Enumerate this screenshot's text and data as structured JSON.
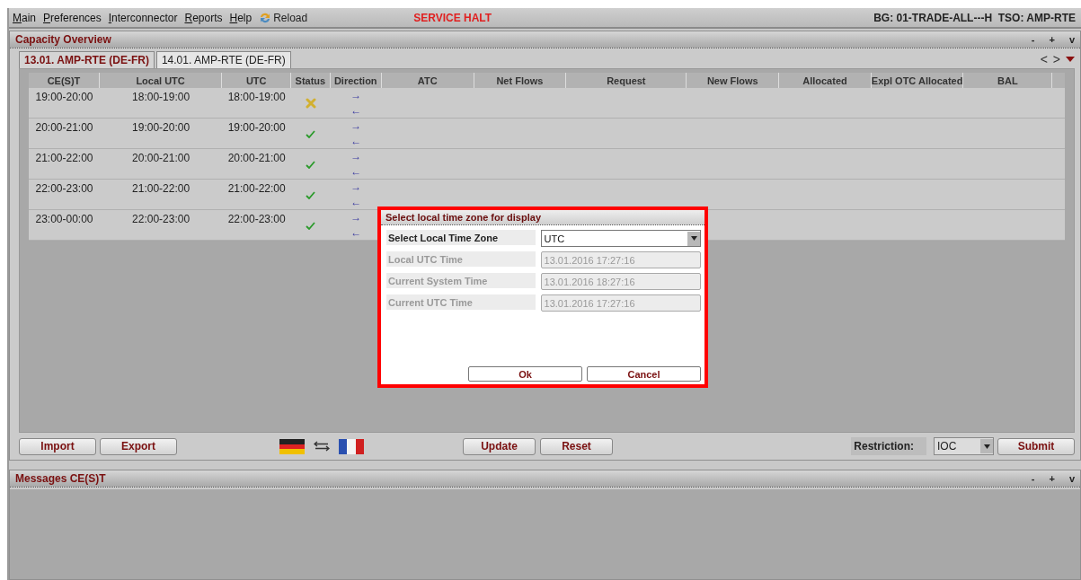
{
  "menu": {
    "items": [
      "Main",
      "Preferences",
      "Interconnector",
      "Reports",
      "Help"
    ],
    "reload": "Reload",
    "alert": "SERVICE HALT",
    "account": "BG: 01-TRADE-ALL---H  TSO: AMP-RTE"
  },
  "capacity_panel": {
    "title": "Capacity Overview",
    "controls": [
      "-",
      "+",
      "v"
    ],
    "tabs": [
      {
        "label": "13.01. AMP-RTE (DE-FR)",
        "selected": true
      },
      {
        "label": "14.01. AMP-RTE (DE-FR)",
        "selected": false
      }
    ],
    "tab_nav": [
      "<",
      ">"
    ],
    "table": {
      "columns": [
        "CE(S)T",
        "Local UTC",
        "UTC",
        "Status",
        "Direction",
        "ATC",
        "Net Flows",
        "Request",
        "New Flows",
        "Allocated",
        "Expl OTC Allocated",
        "BAL"
      ],
      "rows": [
        {
          "cest": "19:00-20:00",
          "local_utc": "18:00-19:00",
          "utc": "18:00-19:00",
          "kind": "error",
          "directions": [
            "→",
            "←"
          ]
        },
        {
          "cest": "20:00-21:00",
          "local_utc": "19:00-20:00",
          "utc": "19:00-20:00",
          "kind": "ok",
          "directions": [
            "→",
            "←"
          ]
        },
        {
          "cest": "21:00-22:00",
          "local_utc": "20:00-21:00",
          "utc": "20:00-21:00",
          "kind": "ok",
          "directions": [
            "→",
            "←"
          ]
        },
        {
          "cest": "22:00-23:00",
          "local_utc": "21:00-22:00",
          "utc": "21:00-22:00",
          "kind": "ok",
          "directions": [
            "→",
            "←"
          ]
        },
        {
          "cest": "23:00-00:00",
          "local_utc": "22:00-23:00",
          "utc": "22:00-23:00",
          "kind": "ok",
          "directions": [
            "→",
            "←"
          ]
        }
      ]
    },
    "buttons_left": [
      "Import",
      "Export"
    ],
    "buttons_mid": [
      "Update",
      "Reset"
    ],
    "restriction": {
      "label": "Restriction:",
      "value": "IOC"
    },
    "submit": "Submit"
  },
  "dialog": {
    "title": "Select local time zone for display",
    "fields": [
      {
        "label": "Select Local Time Zone",
        "value": "UTC",
        "kind": "select",
        "disabled": false
      },
      {
        "label": "Local UTC Time",
        "value": "13.01.2016 17:27:16",
        "kind": "text",
        "disabled": true
      },
      {
        "label": "Current System Time",
        "value": "13.01.2016 18:27:16",
        "kind": "text",
        "disabled": true
      },
      {
        "label": "Current UTC Time",
        "value": "13.01.2016 17:27:16",
        "kind": "text",
        "disabled": true
      }
    ],
    "buttons": [
      "Ok",
      "Cancel"
    ]
  },
  "messages_panel": {
    "title": "Messages CE(S)T",
    "controls": [
      "-",
      "+",
      "v"
    ]
  }
}
